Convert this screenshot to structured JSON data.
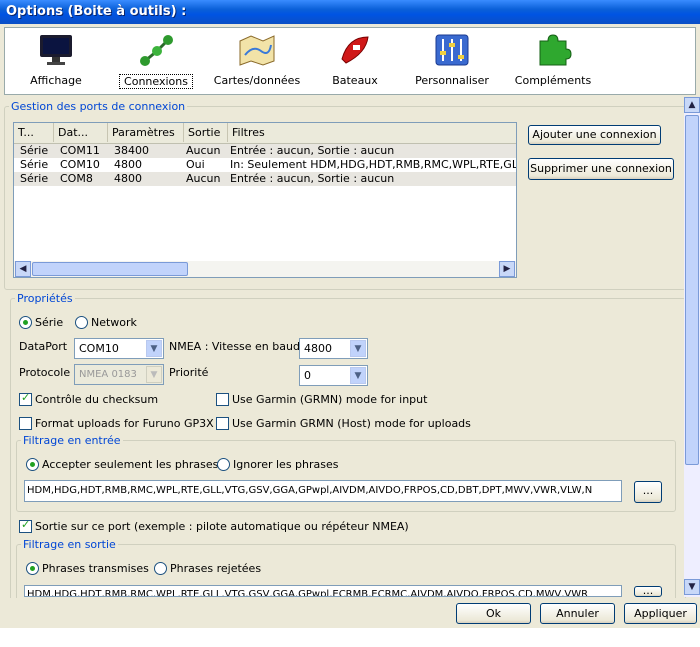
{
  "window": {
    "title": "Options (Boite à outils) :"
  },
  "toolbar": {
    "items": [
      {
        "label": "Affichage",
        "icon": "monitor-icon"
      },
      {
        "label": "Connexions",
        "icon": "connections-icon"
      },
      {
        "label": "Cartes/données",
        "icon": "map-icon"
      },
      {
        "label": "Bateaux",
        "icon": "boat-icon"
      },
      {
        "label": "Personnaliser",
        "icon": "sliders-icon"
      },
      {
        "label": "Compléments",
        "icon": "puzzle-icon"
      }
    ],
    "active": "Connexions"
  },
  "ports": {
    "legend": "Gestion des ports de connexion",
    "columns": [
      "T...",
      "Dat...",
      "Paramètres",
      "Sortie",
      "Filtres"
    ],
    "rows": [
      [
        "Série",
        "COM11",
        "38400",
        "Aucun",
        "Entrée : aucun, Sortie : aucun"
      ],
      [
        "Série",
        "COM10",
        "4800",
        "Oui",
        "In: Seulement HDM,HDG,HDT,RMB,RMC,WPL,RTE,GLL,V"
      ],
      [
        "Série",
        "COM8",
        "4800",
        "Aucun",
        "Entrée : aucun, Sortie : aucun"
      ]
    ],
    "add_button": "Ajouter une connexion",
    "remove_button": "Supprimer une connexion"
  },
  "props": {
    "legend": "Propriétés",
    "radio_serie": "Série",
    "radio_network": "Network",
    "dataport_label": "DataPort",
    "dataport_value": "COM10",
    "baud_label": "NMEA : Vitesse en baud",
    "baud_value": "4800",
    "protocol_label": "Protocole",
    "protocol_value": "NMEA 0183",
    "priority_label": "Priorité",
    "priority_value": "0",
    "checksum": "Contrôle du checksum",
    "garmin_input": "Use Garmin (GRMN) mode for input",
    "furuno": "Format uploads for Furuno GP3X",
    "garmin_upload": "Use Garmin GRMN (Host) mode for uploads",
    "input_filter": {
      "legend": "Filtrage en entrée",
      "accept": "Accepter seulement les phrases",
      "ignore": "Ignorer les phrases",
      "sentences": "HDM,HDG,HDT,RMB,RMC,WPL,RTE,GLL,VTG,GSV,GGA,GPwpl,AIVDM,AIVDO,FRPOS,CD,DBT,DPT,MWV,VWR,VLW,N",
      "browse": "..."
    },
    "output_enable": "Sortie sur ce port (exemple : pilote automatique ou répéteur NMEA)",
    "output_filter": {
      "legend": "Filtrage en sortie",
      "transmitted": "Phrases transmises",
      "rejected": "Phrases rejetées",
      "sentences": "HDM,HDG,HDT,RMB,RMC,WPL,RTE,GLL,VTG,GSV,GGA,GPwpl,ECRMB,ECRMC,AIVDM,AIVDO,FRPOS,CD,MWV,VWR",
      "browse": "..."
    }
  },
  "footer": {
    "ok": "Ok",
    "cancel": "Annuler",
    "apply": "Appliquer"
  }
}
